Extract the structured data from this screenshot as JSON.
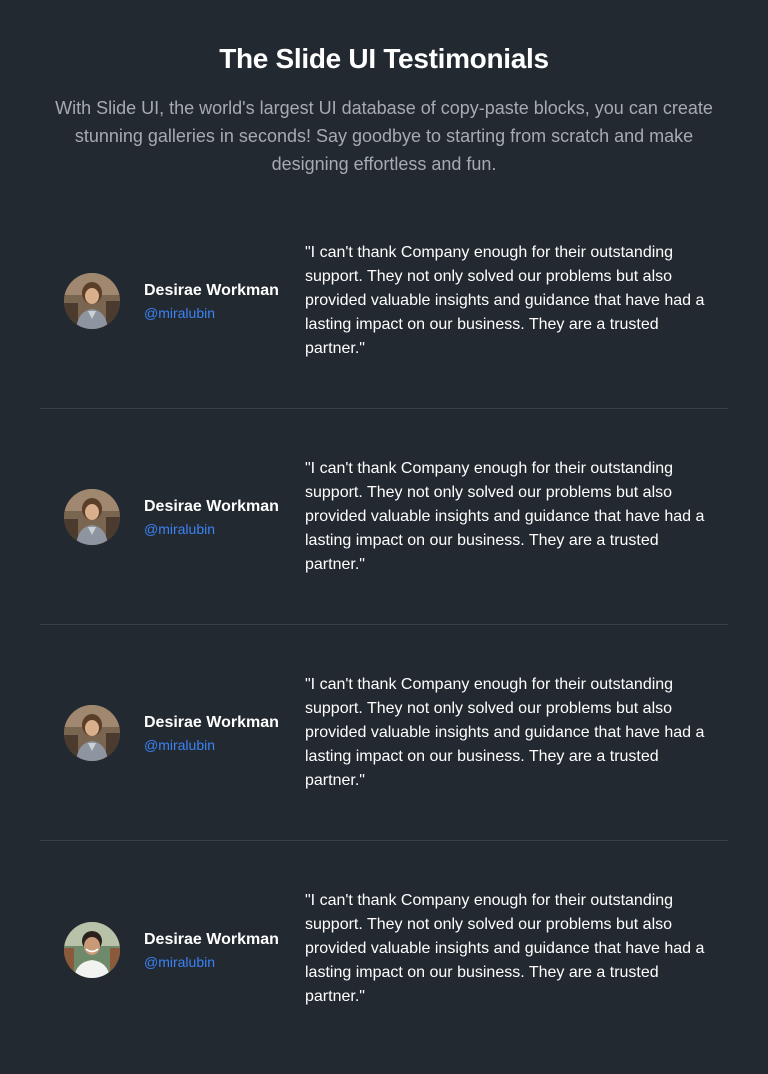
{
  "header": {
    "title": "The Slide UI Testimonials",
    "subtitle": "With Slide UI, the world's largest UI database of copy-paste blocks, you can create stunning galleries in seconds! Say goodbye to starting from scratch and make designing effortless and fun."
  },
  "testimonials": [
    {
      "name": "Desirae Workman",
      "handle": "@miralubin",
      "quote": "\"I can't thank Company enough for their outstanding support. They not only solved our problems but also provided valuable insights and guidance that have had a lasting impact on our business. They are a trusted partner.\""
    },
    {
      "name": "Desirae Workman",
      "handle": "@miralubin",
      "quote": "\"I can't thank Company enough for their outstanding support. They not only solved our problems but also provided valuable insights and guidance that have had a lasting impact on our business. They are a trusted partner.\""
    },
    {
      "name": "Desirae Workman",
      "handle": "@miralubin",
      "quote": "\"I can't thank Company enough for their outstanding support. They not only solved our problems but also provided valuable insights and guidance that have had a lasting impact on our business. They are a trusted partner.\""
    },
    {
      "name": "Desirae Workman",
      "handle": "@miralubin",
      "quote": "\"I can't thank Company enough for their outstanding support. They not only solved our problems but also provided valuable insights and guidance that have had a lasting impact on our business. They are a trusted partner.\""
    }
  ],
  "colors": {
    "background": "#232930",
    "handle_accent": "#3b82f6",
    "subtitle_text": "#a6abb2",
    "divider": "#3a4048"
  }
}
